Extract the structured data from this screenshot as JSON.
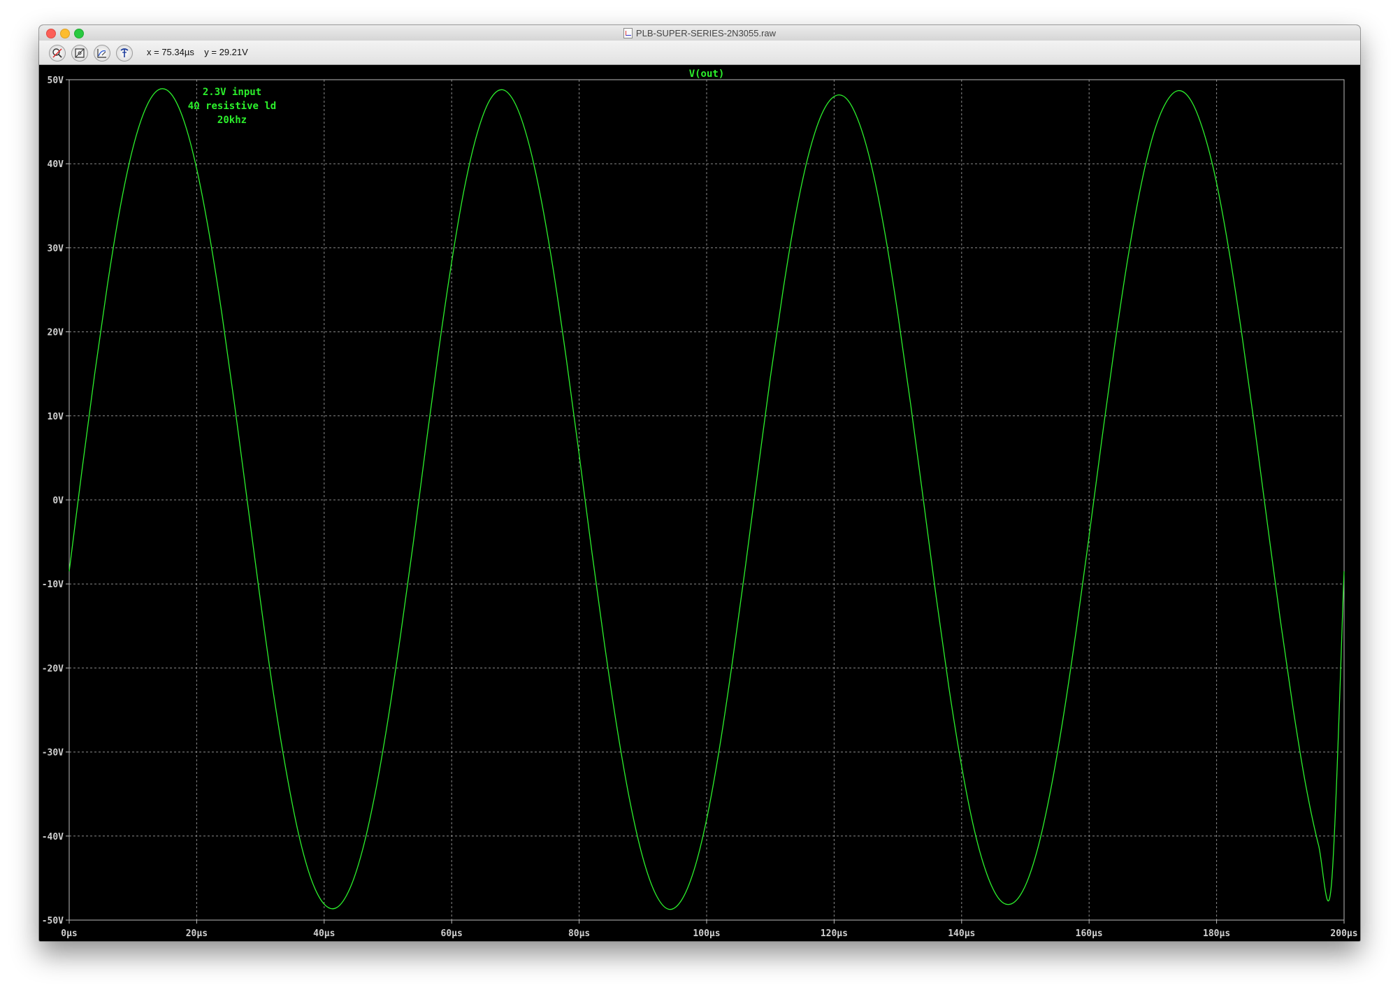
{
  "window": {
    "title": "PLB-SUPER-SERIES-2N3055.raw"
  },
  "toolbar": {
    "tools": [
      {
        "name": "zoom-out-icon"
      },
      {
        "name": "zoom-fit-icon"
      },
      {
        "name": "autorange-icon"
      },
      {
        "name": "probe-icon"
      }
    ],
    "cursor_x": "x = 75.34µs",
    "cursor_y": "y = 29.21V"
  },
  "colors": {
    "trace": "#2cf02c",
    "grid": "#8a8a8a",
    "tick_text": "#cfcfcf",
    "background": "#000000"
  },
  "chart_data": {
    "type": "line",
    "title": "V(out)",
    "annotation": [
      "2.3V input",
      "4Ω resistive ld",
      "20khz"
    ],
    "xlabel": "",
    "ylabel": "",
    "xlim": [
      0,
      200
    ],
    "ylim": [
      -50,
      50
    ],
    "x_unit": "µs",
    "y_unit": "V",
    "x_ticks": [
      0,
      20,
      40,
      60,
      80,
      100,
      120,
      140,
      160,
      180,
      200
    ],
    "x_tick_labels": [
      "0µs",
      "20µs",
      "40µs",
      "60µs",
      "80µs",
      "100µs",
      "120µs",
      "140µs",
      "160µs",
      "180µs",
      "200µs"
    ],
    "y_ticks": [
      50,
      40,
      30,
      20,
      10,
      0,
      -10,
      -20,
      -30,
      -40,
      -50
    ],
    "y_tick_labels": [
      "50V",
      "40V",
      "30V",
      "20V",
      "10V",
      "0V",
      "-10V",
      "-20V",
      "-30V",
      "-40V",
      "-50V"
    ],
    "grid": true,
    "series": [
      {
        "name": "V(out)",
        "x": [
          0,
          2,
          4,
          6,
          8,
          10,
          12,
          14,
          16,
          18,
          20,
          22,
          24,
          26,
          28,
          30,
          32,
          34,
          36,
          38,
          40,
          42,
          44,
          46,
          48,
          50,
          52,
          54,
          56,
          58,
          60,
          62,
          64,
          66,
          68,
          70,
          72,
          74,
          76,
          78,
          80,
          82,
          84,
          86,
          88,
          90,
          92,
          94,
          96,
          98,
          100,
          102,
          104,
          106,
          108,
          110,
          112,
          114,
          116,
          118,
          120,
          122,
          124,
          126,
          128,
          130,
          132,
          134,
          136,
          138,
          140,
          142,
          144,
          146,
          148,
          150,
          152,
          154,
          156,
          158,
          160,
          162,
          164,
          166,
          168,
          170,
          172,
          174,
          176,
          178,
          180,
          182,
          184,
          186,
          188,
          190,
          192,
          194,
          196,
          198,
          200
        ],
        "values": [
          -8.5,
          3.5,
          15.0,
          25.6,
          34.8,
          41.9,
          46.6,
          48.8,
          48.3,
          45.1,
          39.4,
          31.5,
          21.9,
          11.0,
          -0.5,
          -12.0,
          -22.8,
          -32.1,
          -39.8,
          -45.2,
          -48.1,
          -48.5,
          -46.3,
          -41.7,
          -34.9,
          -26.2,
          -16.0,
          -5.0,
          6.7,
          18.0,
          28.3,
          37.1,
          43.6,
          47.6,
          48.8,
          47.1,
          42.7,
          35.9,
          27.1,
          16.7,
          5.4,
          -6.2,
          -17.3,
          -27.4,
          -36.0,
          -42.6,
          -46.9,
          -48.7,
          -47.7,
          -44.1,
          -38.0,
          -29.6,
          -19.5,
          -8.4,
          3.2,
          14.6,
          25.0,
          34.1,
          41.1,
          45.8,
          48.0,
          47.7,
          44.7,
          39.3,
          31.6,
          22.1,
          11.4,
          0.0,
          -11.5,
          -22.3,
          -31.7,
          -39.3,
          -44.6,
          -47.6,
          -48.0,
          -45.9,
          -41.3,
          -34.4,
          -25.6,
          -15.4,
          -4.3,
          7.2,
          18.3,
          28.4,
          36.9,
          43.3,
          47.2,
          48.7,
          47.5,
          43.7,
          37.7,
          29.4,
          19.5,
          8.5,
          -3.0,
          -14.3,
          -24.8,
          -34.0,
          -41.1,
          -45.9,
          -8.5
        ]
      }
    ]
  }
}
